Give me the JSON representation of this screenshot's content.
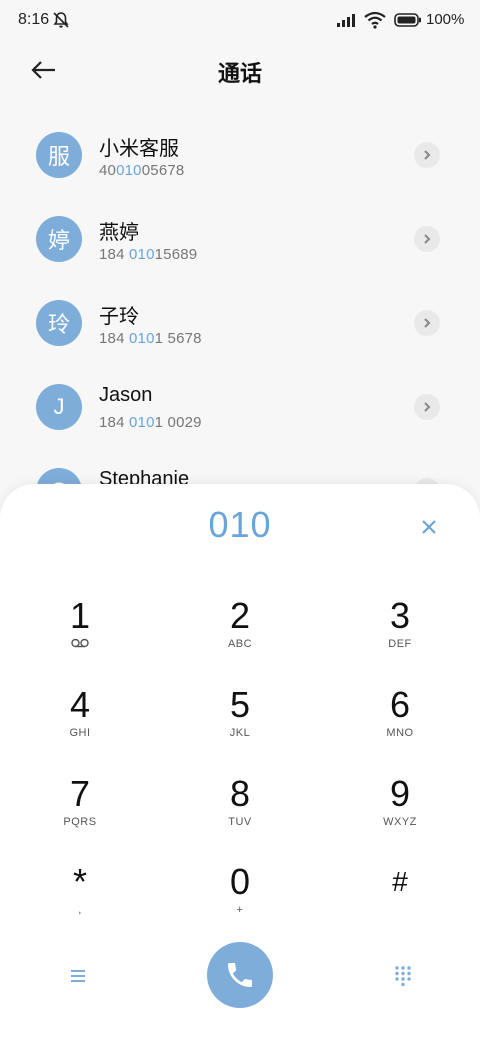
{
  "status_bar": {
    "time": "8:16",
    "battery": "100%",
    "icons": [
      "bell-off-icon",
      "signal-icon",
      "wifi-icon",
      "battery-icon"
    ]
  },
  "header": {
    "title": "通话",
    "back_icon": "arrow-left-icon"
  },
  "contacts": [
    {
      "initial": "服",
      "name": "小米客服",
      "number_pre": "40",
      "number_hl": "010",
      "number_post": "05678"
    },
    {
      "initial": "婷",
      "name": "燕婷",
      "number_pre": "184 ",
      "number_hl": "010",
      "number_post": "15689"
    },
    {
      "initial": "玲",
      "name": "子玲",
      "number_pre": "184 ",
      "number_hl": "010",
      "number_post": "1 5678"
    },
    {
      "initial": "J",
      "name": "Jason",
      "number_pre": "184 ",
      "number_hl": "010",
      "number_post": "1 0029"
    },
    {
      "initial": "S",
      "name": "Stephanie",
      "number_pre": "",
      "number_hl": "",
      "number_post": ""
    }
  ],
  "dialer": {
    "entered_digits": "010",
    "keys": [
      {
        "num": "1",
        "sub": "",
        "icon": "voicemail-icon"
      },
      {
        "num": "2",
        "sub": "ABC"
      },
      {
        "num": "3",
        "sub": "DEF"
      },
      {
        "num": "4",
        "sub": "GHI"
      },
      {
        "num": "5",
        "sub": "JKL"
      },
      {
        "num": "6",
        "sub": "MNO"
      },
      {
        "num": "7",
        "sub": "PQRS"
      },
      {
        "num": "8",
        "sub": "TUV"
      },
      {
        "num": "9",
        "sub": "WXYZ"
      },
      {
        "num": "*",
        "sub": ","
      },
      {
        "num": "0",
        "sub": "+"
      },
      {
        "num": "#",
        "sub": ""
      }
    ]
  },
  "colors": {
    "accent": "#7fadd9",
    "highlight": "#6aa4d8",
    "background": "#f7f7f7"
  }
}
